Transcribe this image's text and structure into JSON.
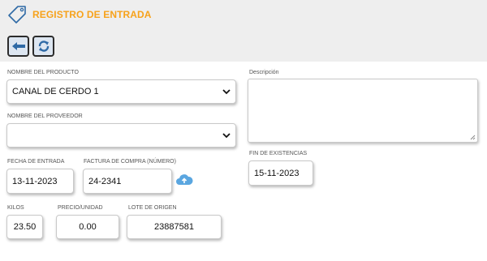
{
  "header": {
    "title": "REGISTRO DE ENTRADA",
    "tag_icon": "tag-icon",
    "accent_color": "#f7a21b"
  },
  "toolbar": {
    "back_icon": "arrow-left-icon",
    "refresh_icon": "refresh-icon"
  },
  "form": {
    "producto": {
      "label": "NOMBRE DEL PRODUCTO",
      "value": "CANAL DE CERDO 1"
    },
    "proveedor": {
      "label": "NOMBRE DEL PROVEEDOR",
      "value": ""
    },
    "descripcion": {
      "label": "Descripción",
      "value": ""
    },
    "fecha_entrada": {
      "label": "FECHA DE ENTRADA",
      "value": "13-11-2023"
    },
    "factura": {
      "label": "FACTURA DE COMPRA (NÚMERO)",
      "value": "24-2341",
      "upload_icon": "cloud-upload-icon"
    },
    "fin_existencias": {
      "label": "FIN DE EXISTENCIAS",
      "value": "15-11-2023"
    },
    "kilos": {
      "label": "KILOS",
      "value": "23.50"
    },
    "precio": {
      "label": "PRECIO/UNIDAD",
      "value": "0.00"
    },
    "lote": {
      "label": "LOTE DE ORIGEN",
      "value": "23887581"
    }
  }
}
